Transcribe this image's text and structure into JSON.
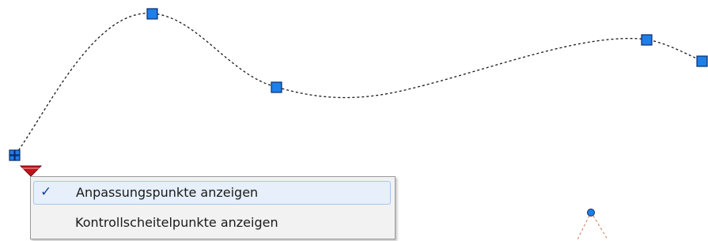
{
  "colors": {
    "grip_fill": "#1e7fe8",
    "grip_stroke": "#0a2a6b",
    "spline_curve": "#1a1a1a",
    "dropdown_marker": "#c0141a",
    "construction_line": "#c97a5a"
  },
  "context_menu": {
    "items": [
      {
        "label": "Anpassungspunkte anzeigen",
        "checked": true,
        "check_glyph": "✓"
      },
      {
        "label": "Kontrollscheitelpunkte anzeigen",
        "checked": false,
        "check_glyph": ""
      }
    ]
  }
}
